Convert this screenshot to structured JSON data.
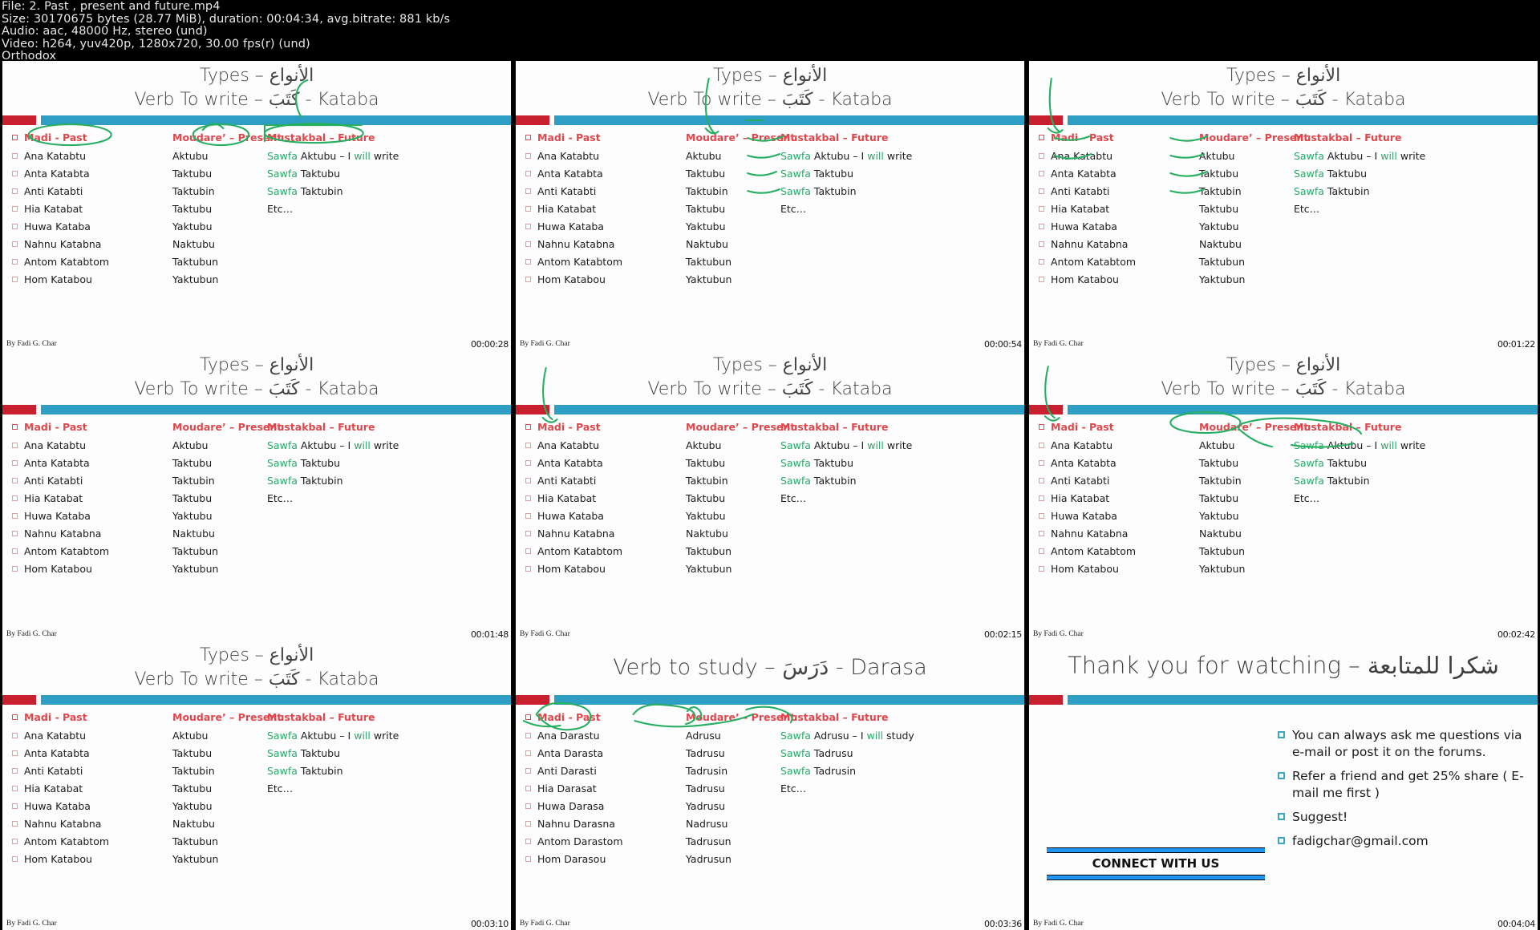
{
  "meta": {
    "lines": [
      "File: 2. Past , present and future.mp4",
      "Size: 30170675 bytes (28.77 MiB), duration: 00:04:34, avg.bitrate: 881 kb/s",
      "Audio: aac, 48000 Hz, stereo (und)",
      "Video: h264, yuv420p, 1280x720, 30.00 fps(r) (und)",
      "Orthodox"
    ]
  },
  "colors": {
    "accent_teal": "#2f9ec4",
    "accent_red": "#c8202e",
    "header_red": "#e0474c",
    "sawfa_green": "#2aa96a",
    "ink_green": "#27ae60",
    "bullet_pink": "#e99ba0",
    "connect_blue": "#2196f3"
  },
  "byline": "By Fadi G. Char",
  "headers": {
    "past": "Madi - Past",
    "present": "Moudare’ – Present",
    "future": "Mustakbal – Future"
  },
  "kataba": {
    "title1": "Types – الأنواع",
    "title2": "Verb To write – كَتَبَ - Kataba",
    "past": [
      "Ana Katabtu",
      "Anta Katabta",
      "Anti Katabti",
      "Hia Katabat",
      "Huwa Kataba",
      "Nahnu Katabna",
      "Antom Katabtom",
      "Hom Katabou"
    ],
    "present": [
      "Aktubu",
      "Taktubu",
      "Taktubin",
      "Taktubu",
      "Yaktubu",
      "Naktubu",
      "Taktubun",
      "Yaktubun"
    ],
    "future": [
      {
        "sawfa": "Sawfa",
        "verb": "Aktubu – I",
        "will": "will",
        "tail": "write"
      },
      {
        "sawfa": "Sawfa",
        "verb": "Taktubu",
        "will": "",
        "tail": ""
      },
      {
        "sawfa": "Sawfa",
        "verb": "Taktubin",
        "will": "",
        "tail": ""
      },
      {
        "sawfa": "",
        "verb": "Etc…",
        "will": "",
        "tail": ""
      }
    ]
  },
  "darasa": {
    "title": "Verb to study –  دَرَسَ - Darasa",
    "past": [
      "Ana Darastu",
      "Anta Darasta",
      "Anti Darasti",
      "Hia Darasat",
      "Huwa Darasa",
      "Nahnu Darasna",
      "Antom Darastom",
      "Hom Darasou"
    ],
    "present": [
      "Adrusu",
      "Tadrusu",
      "Tadrusin",
      "Tadrusu",
      "Yadrusu",
      "Nadrusu",
      "Tadrusun",
      "Yadrusun"
    ],
    "future": [
      {
        "sawfa": "Sawfa",
        "verb": "Adrusu – I",
        "will": "will",
        "tail": "study"
      },
      {
        "sawfa": "Sawfa",
        "verb": "Tadrusu",
        "will": "",
        "tail": ""
      },
      {
        "sawfa": "Sawfa",
        "verb": "Tadrusin",
        "will": "",
        "tail": ""
      },
      {
        "sawfa": "",
        "verb": "Etc…",
        "will": "",
        "tail": ""
      }
    ]
  },
  "thankyou": {
    "title": "Thank you for watching – شكرا للمتابعة",
    "bullets": [
      "You can always ask me questions via e-mail or post it on the forums.",
      "Refer a friend and get 25% share ( E-mail me first )",
      "Suggest!",
      "fadigchar@gmail.com"
    ],
    "connect_label": "CONNECT WITH US"
  },
  "timestamps": [
    "00:00:28",
    "00:00:54",
    "00:01:22",
    "00:01:48",
    "00:02:15",
    "00:02:42",
    "00:03:10",
    "00:03:36",
    "00:04:04"
  ]
}
